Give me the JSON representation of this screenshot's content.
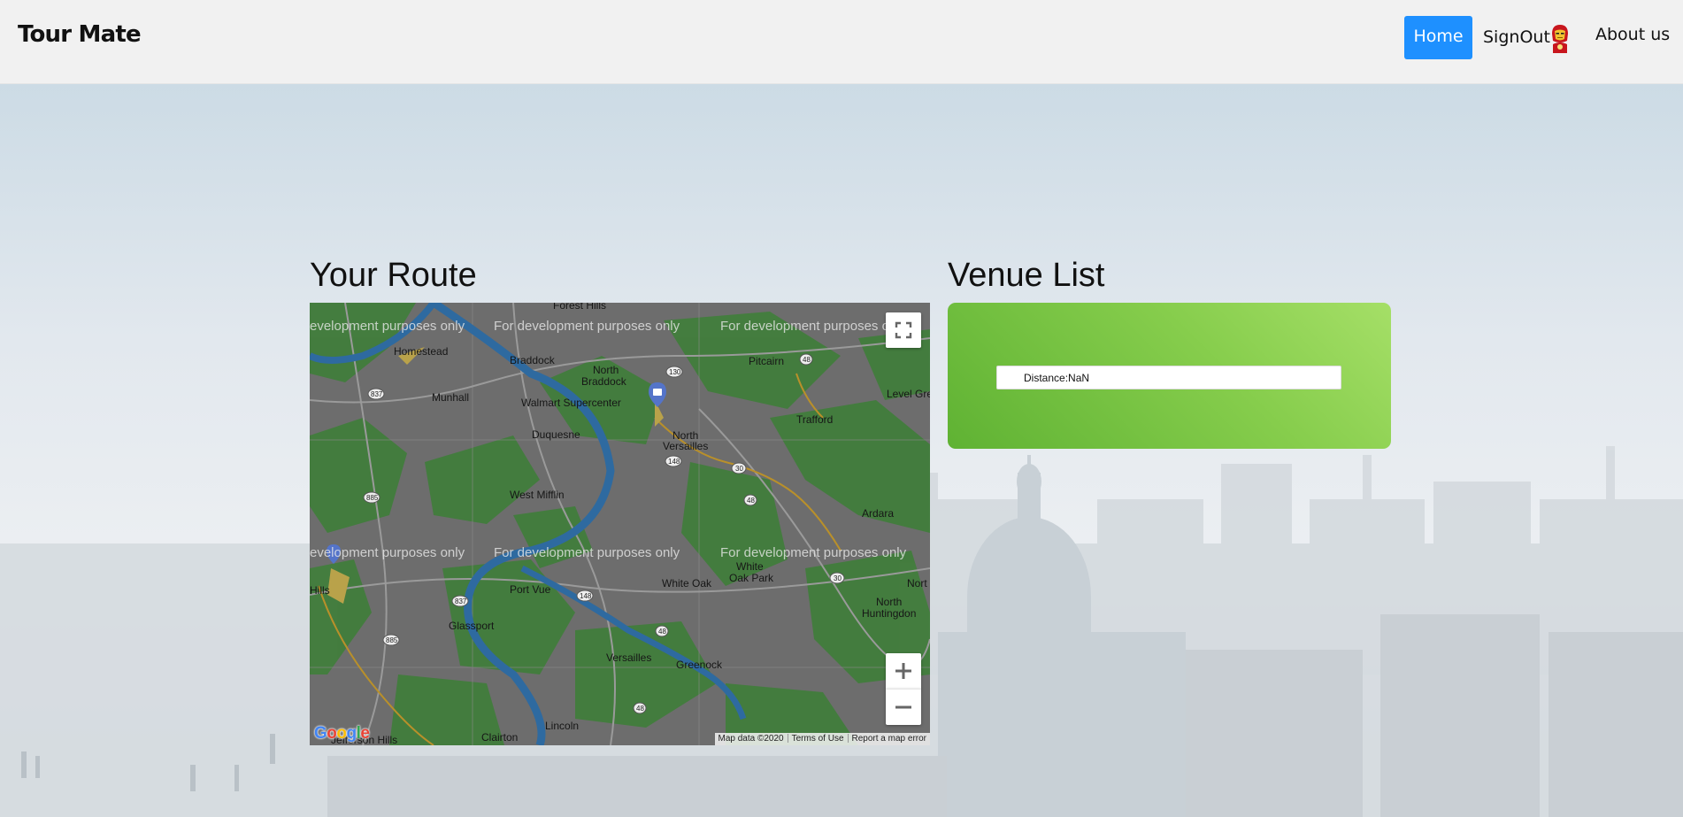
{
  "navbar": {
    "brand": "Tour Mate",
    "home_label": "Home",
    "signout_label": "SignOut",
    "about_label": "About us"
  },
  "route": {
    "heading": "Your Route"
  },
  "venue": {
    "heading": "Venue List",
    "items": [
      {
        "label": "Distance:NaN"
      }
    ]
  },
  "map": {
    "watermark": "For development purposes only",
    "watermark_cut": "evelopment purposes only",
    "watermark_right_cut": "For development purposes o",
    "places": {
      "forest_hills": "Forest Hills",
      "homestead": "Homestead",
      "braddock": "Braddock",
      "north_braddock_1": "North",
      "north_braddock_2": "Braddock",
      "pitcairn": "Pitcairn",
      "munhall": "Munhall",
      "walmart": "Walmart Supercenter",
      "level_green": "Level Gre",
      "duquesne": "Duquesne",
      "north_versailles_1": "North",
      "north_versailles_2": "Versailles",
      "trafford": "Trafford",
      "west_mifflin": "West Mifflin",
      "ardara": "Ardara",
      "hills": "Hills",
      "white_oak_park_1": "White",
      "white_oak_park_2": "Oak Park",
      "white_oak": "White Oak",
      "port_vue": "Port Vue",
      "north_huntingdon_1": "North",
      "north_huntingdon_2": "Huntingdon",
      "nort": "Nort",
      "glassport": "Glassport",
      "versailles": "Versailles",
      "greenock": "Greenock",
      "lincoln": "Lincoln",
      "clairton": "Clairton",
      "jefferson_hills": "Jefferson Hills"
    },
    "shields": [
      "837",
      "130",
      "48",
      "148",
      "30",
      "885",
      "48",
      "837",
      "148",
      "48",
      "30",
      "885",
      "48",
      "130"
    ],
    "attribution": {
      "map_data": "Map data ©2020",
      "terms": "Terms of Use",
      "report": "Report a map error"
    },
    "logo": "Google"
  },
  "colors": {
    "home_button": "#1e90ff",
    "venue_panel_start": "#a5df67",
    "venue_panel_end": "#5fb233"
  },
  "icons": {
    "fullscreen": "fullscreen-icon",
    "zoom_in": "plus-icon",
    "zoom_out": "minus-icon",
    "avatar": "ironman-avatar-icon",
    "poi": "shopping-bag-icon"
  }
}
